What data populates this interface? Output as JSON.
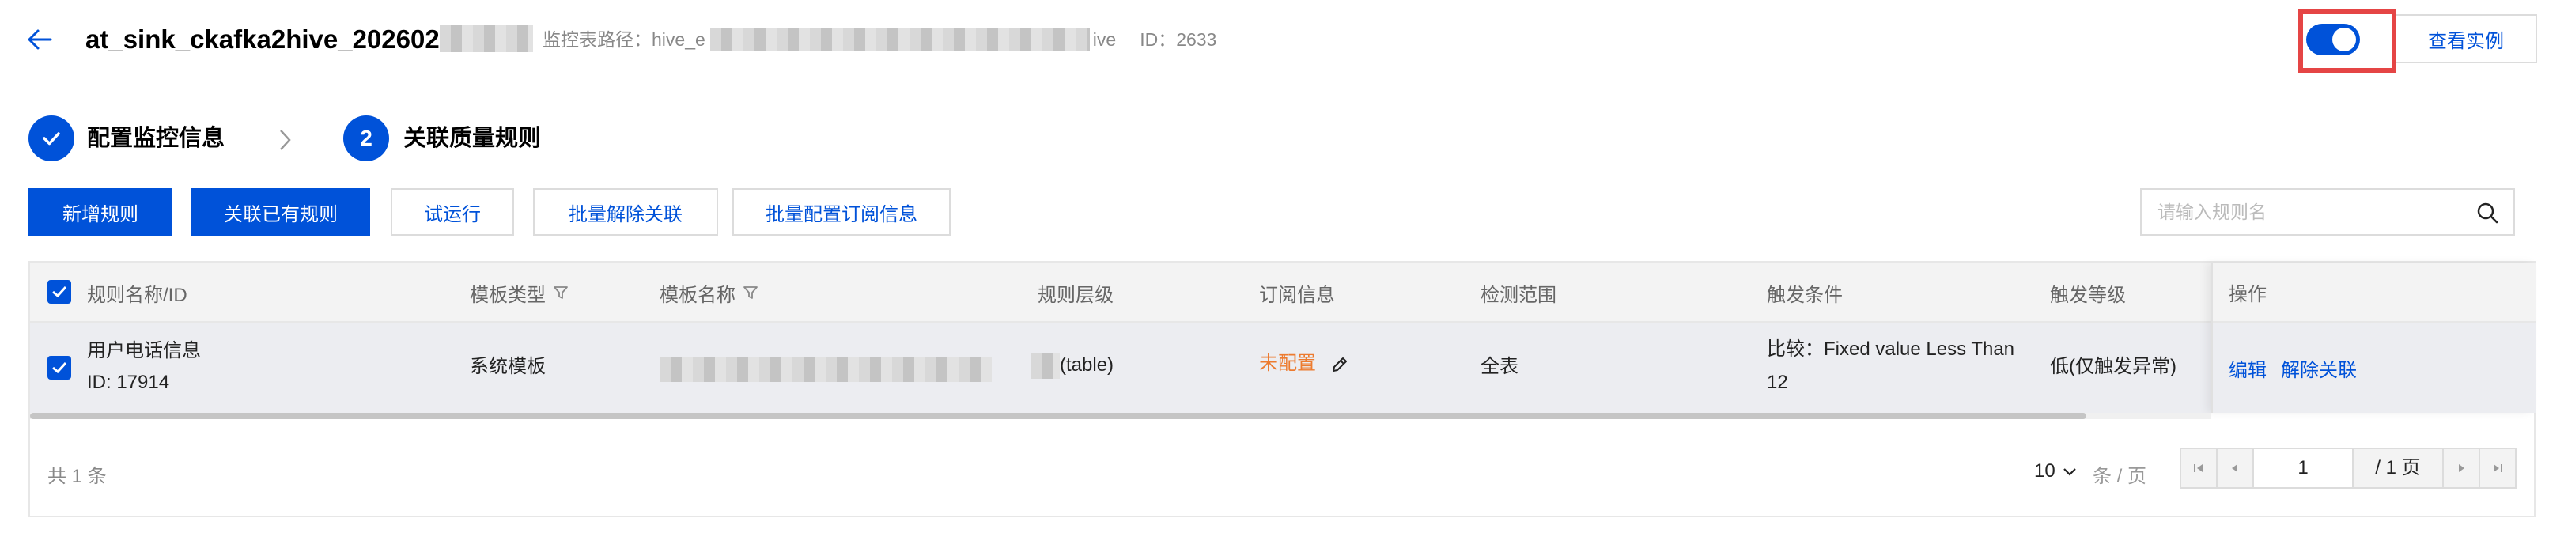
{
  "header": {
    "title": "at_sink_ckafka2hive_202602",
    "path_label": "监控表路径：hive_e",
    "path_suffix": "ive",
    "id_label": "ID：2633",
    "view_instance": "查看实例",
    "toggle_on": true
  },
  "steps": [
    {
      "label": "配置监控信息",
      "status": "done"
    },
    {
      "label": "关联质量规则",
      "number": "2",
      "status": "active"
    }
  ],
  "toolbar": {
    "buttons": [
      "新增规则",
      "关联已有规则",
      "试运行",
      "批量解除关联",
      "批量配置订阅信息"
    ],
    "search_placeholder": "请输入规则名"
  },
  "table": {
    "columns": [
      "规则名称/ID",
      "模板类型",
      "模板名称",
      "规则层级",
      "订阅信息",
      "检测范围",
      "触发条件",
      "触发等级",
      "操作"
    ],
    "rows": [
      {
        "name": "用户电话信息",
        "id": "ID: 17914",
        "template_type": "系统模板",
        "rule_level": "(table)",
        "subscription": "未配置",
        "scope": "全表",
        "trigger_line1": "比较：Fixed value Less Than",
        "trigger_line2": "12",
        "trigger_level": "低(仅触发异常)",
        "actions": [
          "编辑",
          "解除关联"
        ]
      }
    ]
  },
  "pagination": {
    "total": "共 1 条",
    "page_size": "10",
    "per_page_label": "条 / 页",
    "current_page": "1",
    "total_pages": "/ 1 页"
  },
  "colors": {
    "primary": "#0052d9",
    "warning": "#ed7b2f",
    "highlight_frame": "#e54545"
  }
}
